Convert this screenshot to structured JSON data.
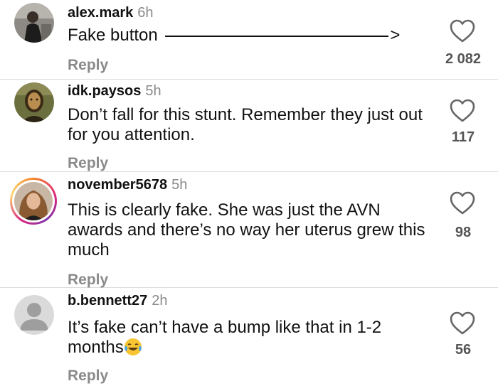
{
  "comments": [
    {
      "username": "alex.mark",
      "time": "6h",
      "text": "Fake button",
      "arrow_tail": ">",
      "reply_label": "Reply",
      "likes": "2 082"
    },
    {
      "username": "idk.paysos",
      "time": "5h",
      "text": "Don’t fall for this stunt. Remember they just out for you attention.",
      "reply_label": "Reply",
      "likes": "117"
    },
    {
      "username": "november5678",
      "time": "5h",
      "text": "This is clearly fake. She was just the AVN awards and there’s no way her uterus grew this much",
      "reply_label": "Reply",
      "likes": "98"
    },
    {
      "username": "b.bennett27",
      "time": "2h",
      "text": "It’s fake can’t have a bump like that in 1-2 months",
      "emoji": "face-with-tears-of-joy",
      "reply_label": "Reply",
      "likes": "56"
    }
  ],
  "colors": {
    "text": "#111111",
    "muted": "#8a8a8a",
    "divider": "#dcdcdc"
  }
}
